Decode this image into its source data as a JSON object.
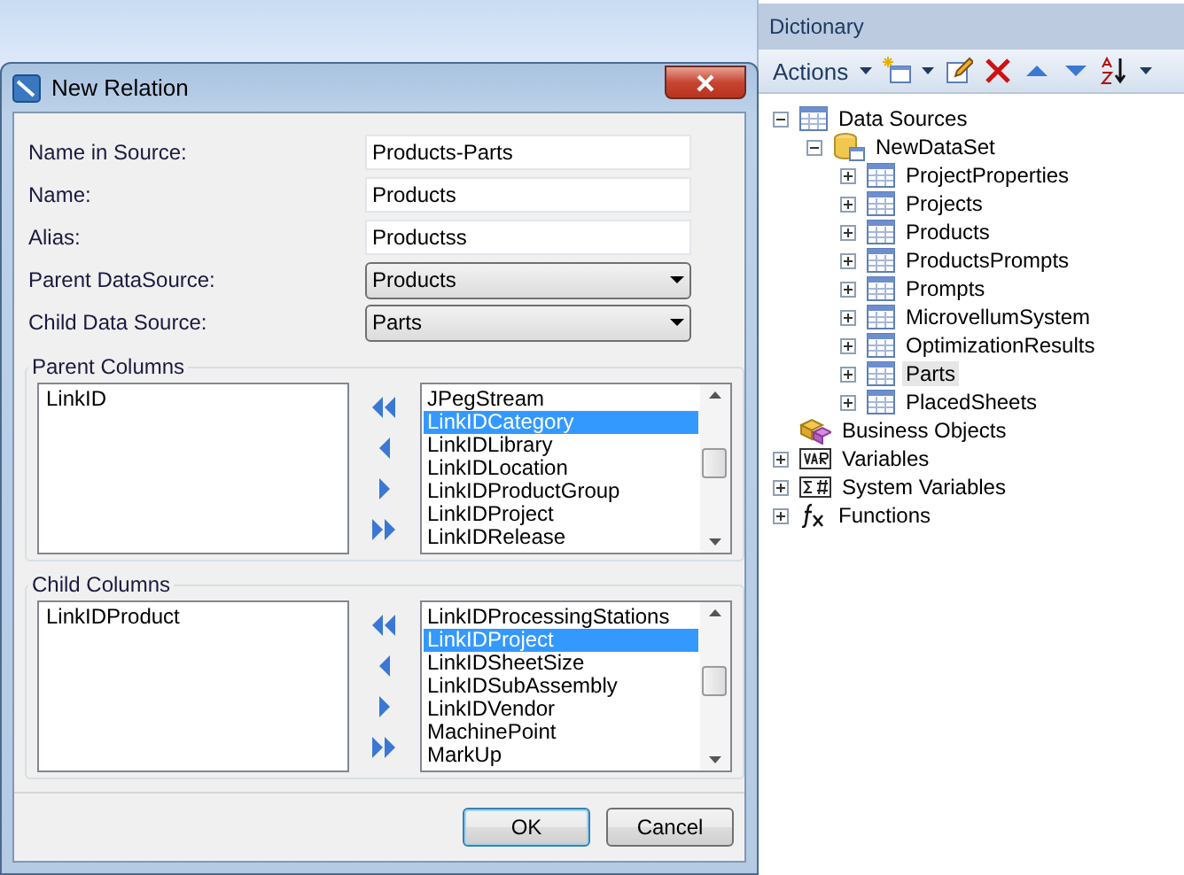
{
  "dialog": {
    "title": "New Relation",
    "fields": [
      {
        "kind": "text",
        "label": "Name in Source:",
        "value": "Products-Parts"
      },
      {
        "kind": "text",
        "label": "Name:",
        "value": "Products"
      },
      {
        "kind": "text",
        "label": "Alias:",
        "value": "Productss"
      },
      {
        "kind": "dropdown",
        "label": "Parent DataSource:",
        "value": "Products"
      },
      {
        "kind": "dropdown",
        "label": "Child Data Source:",
        "value": "Parts"
      }
    ],
    "groups": [
      {
        "title": "Parent Columns",
        "chosen": [
          "LinkID"
        ],
        "available": [
          {
            "label": "JPegStream",
            "selected": false
          },
          {
            "label": "LinkIDCategory",
            "selected": true
          },
          {
            "label": "LinkIDLibrary",
            "selected": false
          },
          {
            "label": "LinkIDLocation",
            "selected": false
          },
          {
            "label": "LinkIDProductGroup",
            "selected": false
          },
          {
            "label": "LinkIDProject",
            "selected": false
          },
          {
            "label": "LinkIDRelease",
            "selected": false
          }
        ]
      },
      {
        "title": "Child Columns",
        "chosen": [
          "LinkIDProduct"
        ],
        "available": [
          {
            "label": "LinkIDProcessingStations",
            "selected": false
          },
          {
            "label": "LinkIDProject",
            "selected": true
          },
          {
            "label": "LinkIDSheetSize",
            "selected": false
          },
          {
            "label": "LinkIDSubAssembly",
            "selected": false
          },
          {
            "label": "LinkIDVendor",
            "selected": false
          },
          {
            "label": "MachinePoint",
            "selected": false
          },
          {
            "label": "MarkUp",
            "selected": false
          }
        ]
      }
    ],
    "buttons": [
      {
        "label": "OK",
        "default": true
      },
      {
        "label": "Cancel",
        "default": false
      }
    ]
  },
  "dictionary": {
    "title": "Dictionary",
    "toolbar": {
      "actions": "Actions"
    },
    "tree": [
      {
        "label": "Data Sources",
        "kind": "table",
        "expanded": true,
        "selected": false,
        "children": [
          {
            "label": "NewDataSet",
            "kind": "database",
            "expanded": true,
            "selected": false,
            "children": [
              {
                "label": "ProjectProperties",
                "kind": "table",
                "expanded": false,
                "selected": false
              },
              {
                "label": "Projects",
                "kind": "table",
                "expanded": false,
                "selected": false
              },
              {
                "label": "Products",
                "kind": "table",
                "expanded": false,
                "selected": false
              },
              {
                "label": "ProductsPrompts",
                "kind": "table",
                "expanded": false,
                "selected": false
              },
              {
                "label": "Prompts",
                "kind": "table",
                "expanded": false,
                "selected": false
              },
              {
                "label": "MicrovellumSystem",
                "kind": "table",
                "expanded": false,
                "selected": false
              },
              {
                "label": "OptimizationResults",
                "kind": "table",
                "expanded": false,
                "selected": false
              },
              {
                "label": "Parts",
                "kind": "table",
                "expanded": false,
                "selected": true
              },
              {
                "label": "PlacedSheets",
                "kind": "table",
                "expanded": false,
                "selected": false
              }
            ]
          }
        ]
      },
      {
        "label": "Business Objects",
        "kind": "business",
        "selected": false
      },
      {
        "label": "Variables",
        "kind": "variables",
        "expanded": false,
        "selected": false
      },
      {
        "label": "System Variables",
        "kind": "sysvars",
        "expanded": false,
        "selected": false
      },
      {
        "label": "Functions",
        "kind": "functions",
        "expanded": false,
        "selected": false
      }
    ]
  }
}
